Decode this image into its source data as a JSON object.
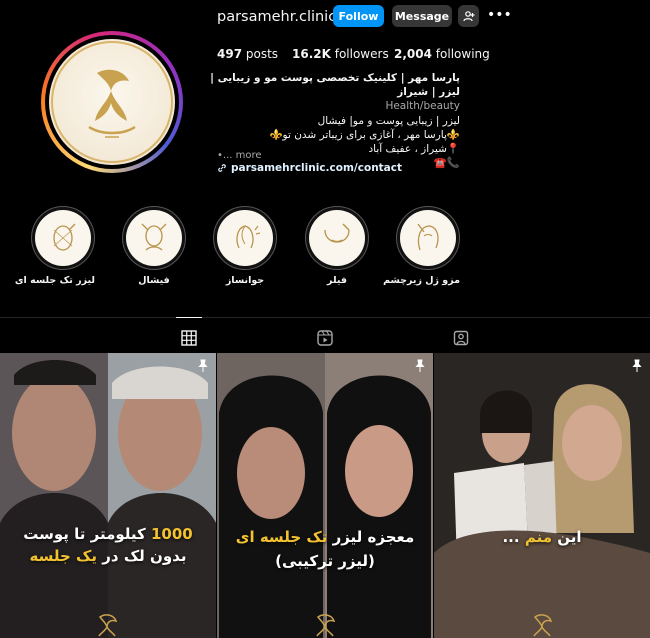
{
  "profile": {
    "username": "parsamehr.clinic",
    "follow_label": "Follow",
    "message_label": "Message",
    "posts_count": "497",
    "posts_label": "posts",
    "followers_count": "16.2K",
    "followers_label": "followers",
    "following_count": "2,004",
    "following_label": "following"
  },
  "bio": {
    "name": "پارسا مهر | کلینیک تخصصی پوست مو و زیبایی | لیزر | شیراز",
    "category": "Health/beauty",
    "line1": "لیزر | زیبایی پوست و مو| فیشال",
    "line2": "⚜️پارسا مهر ، آغازی برای زیباتر شدن تو⚜️",
    "line3": "📍شیراز ، عفیف آباد",
    "line4": "📞☎️",
    "more": "•... more",
    "link": "parsamehrclinic.com/contact"
  },
  "highlights": [
    {
      "label": "لیزر تک جلسه ای",
      "icon": "face-laser-icon"
    },
    {
      "label": "فیشال",
      "icon": "facial-icon"
    },
    {
      "label": "جوانساز",
      "icon": "rejuvenation-icon"
    },
    {
      "label": "فیلر",
      "icon": "filler-icon"
    },
    {
      "label": "مزو ژل زیرچشم",
      "icon": "under-eye-icon"
    }
  ],
  "tabs": [
    {
      "name": "posts",
      "icon": "grid-icon",
      "active": true
    },
    {
      "name": "reels",
      "icon": "reels-icon",
      "active": false
    },
    {
      "name": "tagged",
      "icon": "tagged-icon",
      "active": false
    }
  ],
  "posts": [
    {
      "caption_line1_a": "1000",
      "caption_line1_b": " کیلومتر تا پوست",
      "caption_line2_a": "بدون لک در ",
      "caption_line2_b": "یک جلسه",
      "pinned": true
    },
    {
      "caption_line1_a": "معجزه لیزر ",
      "caption_line1_b": "تک جلسه ای",
      "caption_line2_a": "(لیزر ترکیبی)",
      "caption_line2_b": "",
      "pinned": true
    },
    {
      "caption_line1_a": "این ",
      "caption_line1_b": "منم",
      "caption_line2_a": " ...",
      "caption_line2_b": "",
      "pinned": true
    }
  ],
  "colors": {
    "accent": "#0095f6",
    "button_secondary": "#363636",
    "caption_highlight": "#f2c230"
  }
}
